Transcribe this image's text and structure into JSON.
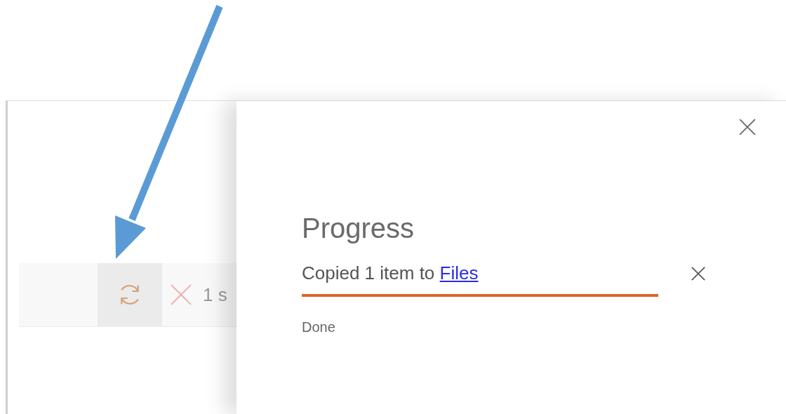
{
  "toolbar": {
    "buttons": [
      {
        "kind": "refresh",
        "highlighted": true
      },
      {
        "kind": "delete",
        "highlighted": false
      }
    ],
    "selection_text": "1 s"
  },
  "panel": {
    "title": "Progress",
    "items": [
      {
        "message": "Copied 1 item to",
        "link": "Files",
        "level": 1,
        "status": "Done"
      }
    ]
  }
}
